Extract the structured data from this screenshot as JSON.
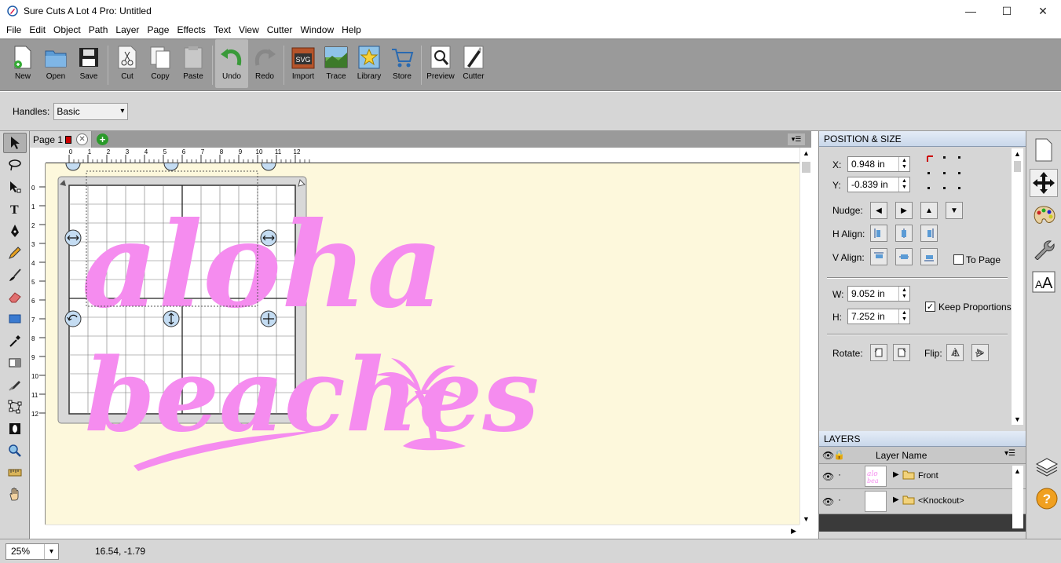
{
  "window": {
    "title": "Sure Cuts A Lot 4 Pro: Untitled",
    "icon": "pen-nib-icon",
    "controls": [
      "minimize-icon",
      "maximize-icon",
      "close-icon"
    ]
  },
  "menu": [
    "File",
    "Edit",
    "Object",
    "Path",
    "Layer",
    "Page",
    "Effects",
    "Text",
    "View",
    "Cutter",
    "Window",
    "Help"
  ],
  "toolbar": {
    "groups": [
      [
        {
          "label": "New",
          "icon": "new-document-icon"
        },
        {
          "label": "Open",
          "icon": "open-folder-icon"
        },
        {
          "label": "Save",
          "icon": "floppy-disk-icon"
        }
      ],
      [
        {
          "label": "Cut",
          "icon": "scissors-icon"
        },
        {
          "label": "Copy",
          "icon": "copy-icon"
        },
        {
          "label": "Paste",
          "icon": "paste-icon"
        }
      ],
      [
        {
          "label": "Undo",
          "icon": "undo-icon"
        },
        {
          "label": "Redo",
          "icon": "redo-icon"
        }
      ],
      [
        {
          "label": "Import",
          "icon": "import-svg-icon"
        },
        {
          "label": "Trace",
          "icon": "trace-icon"
        },
        {
          "label": "Library",
          "icon": "library-star-icon"
        },
        {
          "label": "Store",
          "icon": "store-cart-icon"
        }
      ],
      [
        {
          "label": "Preview",
          "icon": "preview-magnifier-icon"
        },
        {
          "label": "Cutter",
          "icon": "cutter-knife-icon"
        }
      ]
    ]
  },
  "handles": {
    "label": "Handles:",
    "value": "Basic"
  },
  "left_tools": [
    "select-arrow-icon",
    "lasso-icon",
    "node-edit-icon",
    "text-tool-icon",
    "pen-tool-icon",
    "pencil-icon",
    "brush-icon",
    "eraser-icon",
    "shape-rect-icon",
    "eyedropper-icon",
    "gradient-icon",
    "knife-icon",
    "bounding-icon",
    "contour-icon",
    "zoom-icon",
    "ruler-measure-icon",
    "hand-pan-icon"
  ],
  "page_tab": {
    "label": "Page 1"
  },
  "ruler": {
    "h_ticks": [
      "0",
      "1",
      "2",
      "3",
      "4",
      "5",
      "6",
      "7",
      "8",
      "9",
      "10",
      "11",
      "12"
    ],
    "v_ticks": [
      "0",
      "1",
      "2",
      "3",
      "4",
      "5",
      "6",
      "7",
      "8",
      "9",
      "10",
      "11",
      "12"
    ]
  },
  "artwork": {
    "color": "#f58cef",
    "canvas_bg": "#fdf8dc",
    "line1": "aloha",
    "line2": "beaches"
  },
  "position_size": {
    "header": "POSITION & SIZE",
    "x_label": "X:",
    "x_value": "0.948 in",
    "y_label": "Y:",
    "y_value": "-0.839 in",
    "nudge_label": "Nudge:",
    "halign_label": "H Align:",
    "valign_label": "V Align:",
    "to_page_label": "To Page",
    "w_label": "W:",
    "w_value": "9.052 in",
    "h_label": "H:",
    "h_value": "7.252 in",
    "keep_proportions_label": "Keep Proportions",
    "rotate_label": "Rotate:",
    "flip_label": "Flip:"
  },
  "layers": {
    "header": "LAYERS",
    "column": "Layer Name",
    "items": [
      {
        "name": "Front"
      },
      {
        "name": "<Knockout>"
      }
    ]
  },
  "status": {
    "zoom": "25%",
    "coords": "16.54, -1.79"
  }
}
